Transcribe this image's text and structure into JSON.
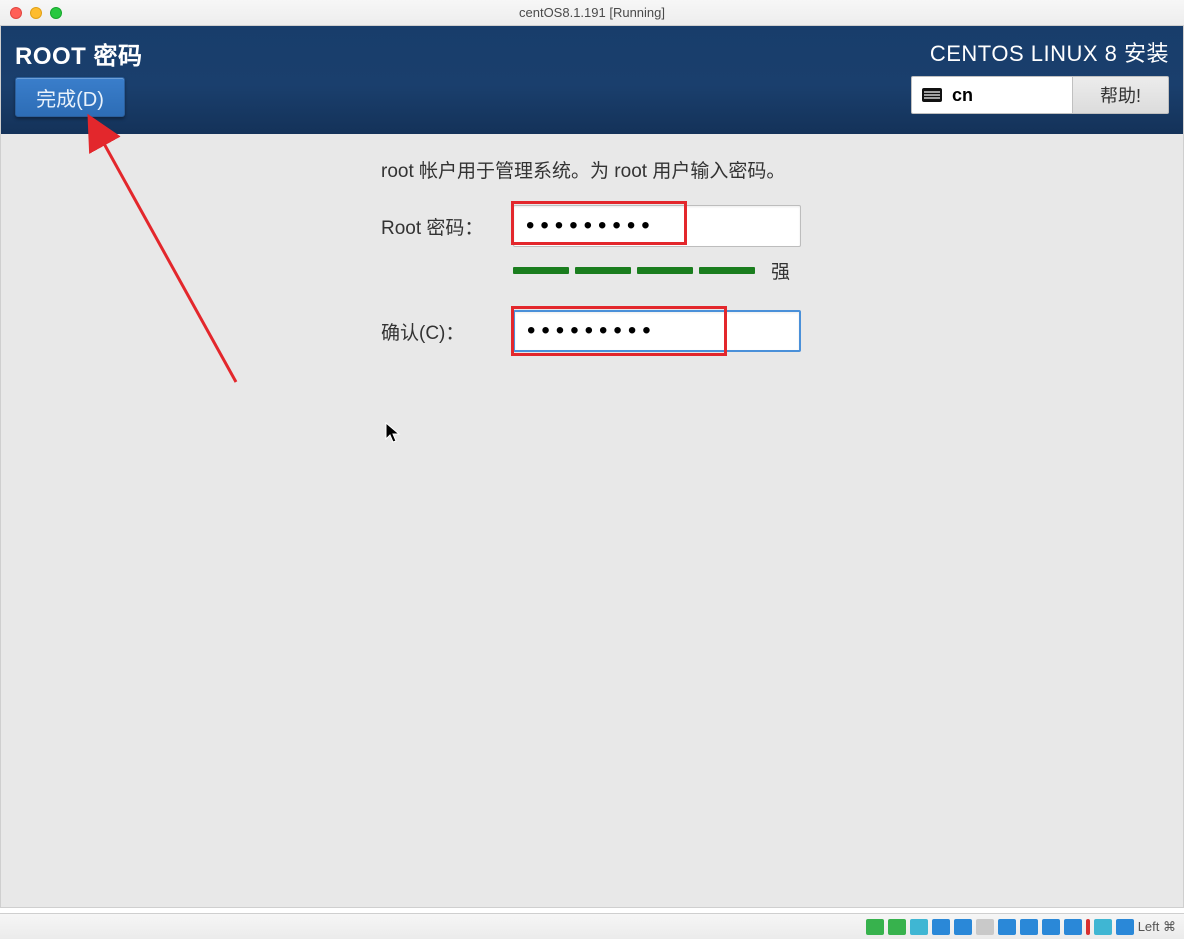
{
  "window": {
    "title": "centOS8.1.191 [Running]"
  },
  "header": {
    "page_title": "ROOT 密码",
    "done_label": "完成(D)",
    "install_title": "CENTOS LINUX 8 安装",
    "language_selected": "cn",
    "help_label": "帮助!"
  },
  "form": {
    "intro": "root 帐户用于管理系统。为 root 用户输入密码。",
    "password_label": "Root 密码：",
    "password_value": "●●●●●●●●●",
    "confirm_label": "确认(C)：",
    "confirm_value": "●●●●●●●●●",
    "strength_label": "强"
  },
  "statusbar": {
    "text": "Left ⌘"
  }
}
